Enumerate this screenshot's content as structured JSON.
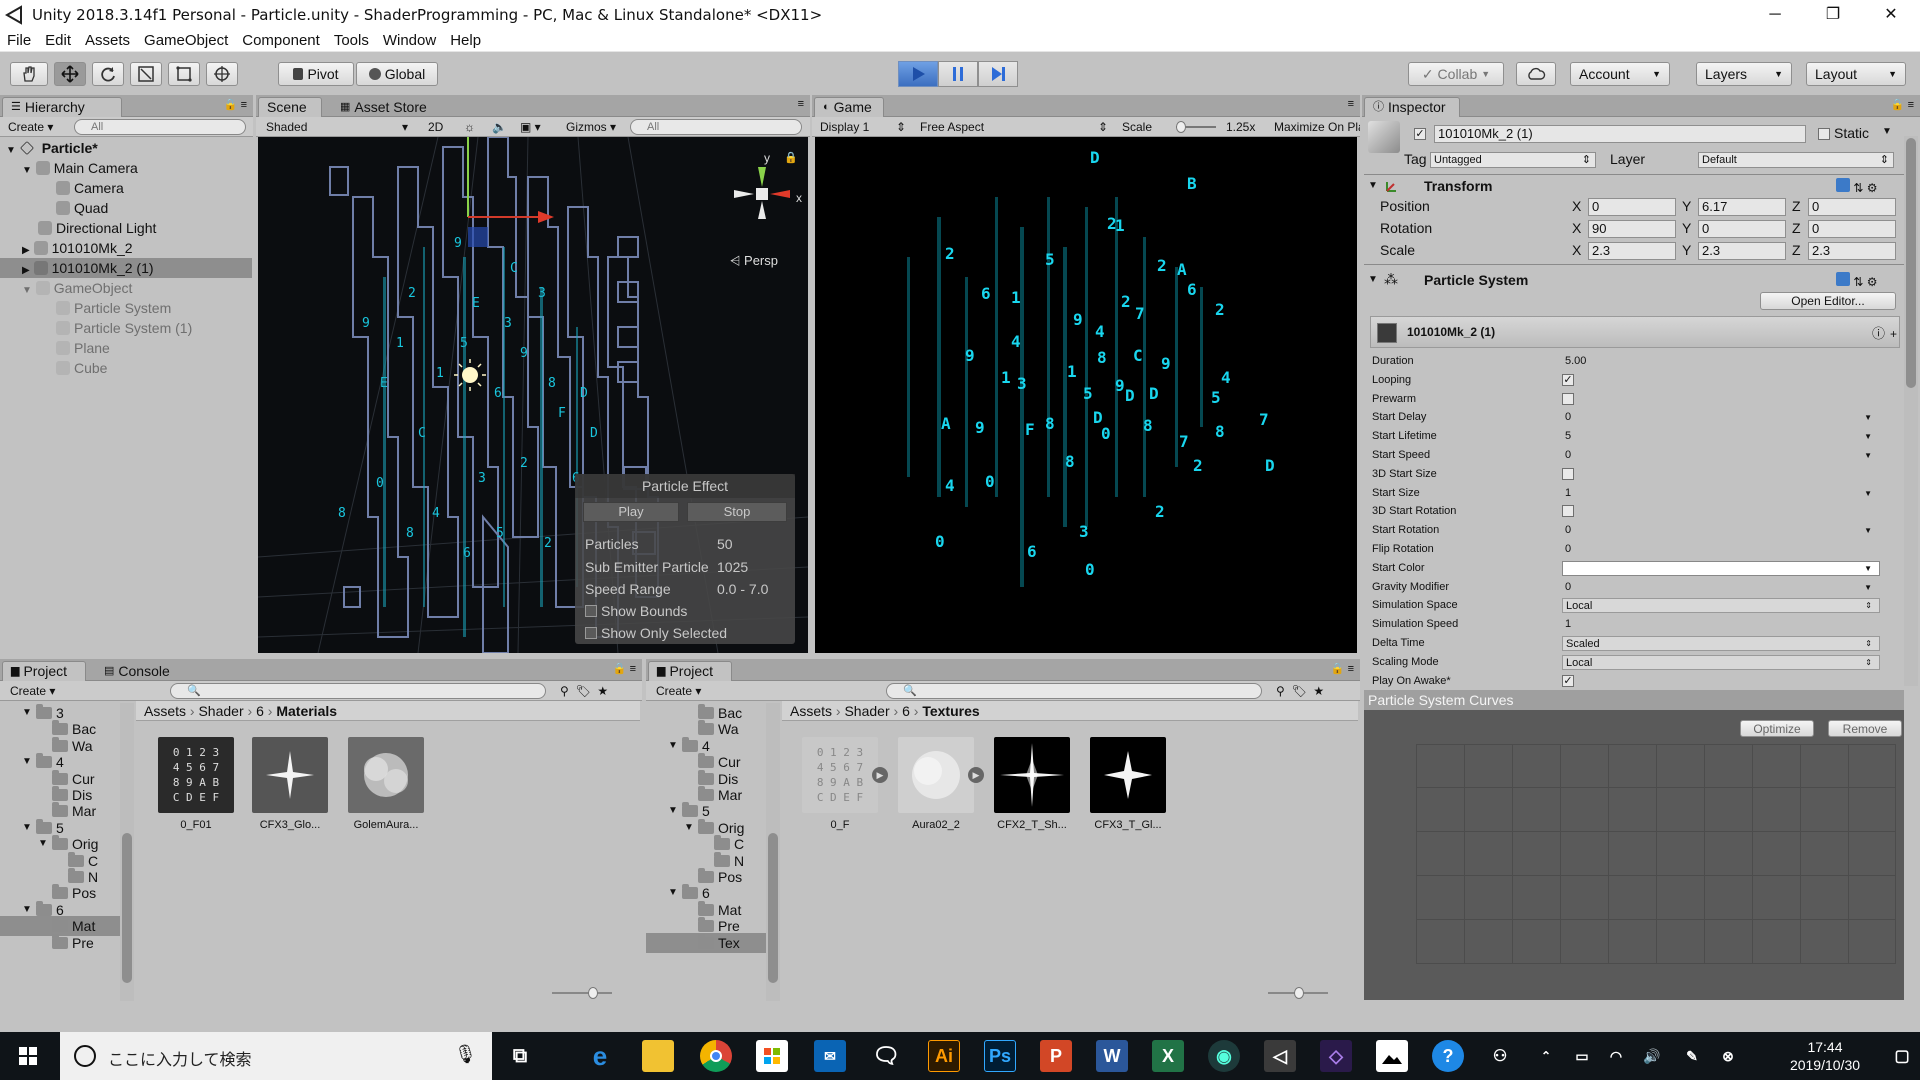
{
  "window": {
    "title": "Unity 2018.3.14f1 Personal - Particle.unity - ShaderProgramming - PC, Mac & Linux Standalone* <DX11>",
    "minimize": "─",
    "maximize": "❐",
    "close": "✕"
  },
  "menu": [
    "File",
    "Edit",
    "Assets",
    "GameObject",
    "Component",
    "Tools",
    "Window",
    "Help"
  ],
  "toolbar": {
    "pivot": "Pivot",
    "global": "Global",
    "collab": "Collab",
    "account": "Account",
    "layers": "Layers",
    "layout": "Layout"
  },
  "hierarchy": {
    "tab": "Hierarchy",
    "create": "Create",
    "search_placeholder": "All",
    "scene": "Particle*",
    "items": [
      {
        "label": "Main Camera"
      },
      {
        "label": "Camera"
      },
      {
        "label": "Quad"
      },
      {
        "label": "Directional Light"
      },
      {
        "label": "101010Mk_2"
      },
      {
        "label": "101010Mk_2 (1)"
      },
      {
        "label": "GameObject"
      },
      {
        "label": "Particle System"
      },
      {
        "label": "Particle System (1)"
      },
      {
        "label": "Plane"
      },
      {
        "label": "Cube"
      }
    ]
  },
  "scene": {
    "tab": "Scene",
    "asset_store_tab": "Asset Store",
    "shading": "Shaded",
    "mode_2d": "2D",
    "gizmos": "Gizmos",
    "search_placeholder": "All",
    "persp": "Persp",
    "axis_x": "x",
    "axis_y": "y"
  },
  "particle_effect": {
    "title": "Particle Effect",
    "play": "Play",
    "stop": "Stop",
    "particles_label": "Particles",
    "particles_value": "50",
    "sub_emitter_label": "Sub Emitter Particle",
    "sub_emitter_value": "1025",
    "speed_label": "Speed Range",
    "speed_value": "0.0 - 7.0",
    "show_bounds": "Show Bounds",
    "show_only_selected": "Show Only Selected"
  },
  "game": {
    "tab": "Game",
    "display": "Display 1",
    "aspect": "Free Aspect",
    "scale_label": "Scale",
    "scale_value": "1.25x",
    "maximize": "Maximize On Pla"
  },
  "inspector": {
    "tab": "Inspector",
    "object_name": "101010Mk_2 (1)",
    "static": "Static",
    "tag_label": "Tag",
    "tag_value": "Untagged",
    "layer_label": "Layer",
    "layer_value": "Default",
    "transform": {
      "title": "Transform",
      "position_label": "Position",
      "rotation_label": "Rotation",
      "scale_label": "Scale",
      "position": {
        "x": "0",
        "y": "6.17",
        "z": "0"
      },
      "rotation": {
        "x": "90",
        "y": "0",
        "z": "0"
      },
      "scale": {
        "x": "2.3",
        "y": "2.3",
        "z": "2.3"
      }
    },
    "particle_system": {
      "title": "Particle System",
      "open_editor": "Open Editor...",
      "module_name": "101010Mk_2 (1)",
      "rows": [
        {
          "label": "Duration",
          "value": "5.00",
          "kind": "text"
        },
        {
          "label": "Looping",
          "value": "✓",
          "kind": "check"
        },
        {
          "label": "Prewarm",
          "value": "",
          "kind": "check"
        },
        {
          "label": "Start Delay",
          "value": "0",
          "kind": "drop"
        },
        {
          "label": "Start Lifetime",
          "value": "5",
          "kind": "drop"
        },
        {
          "label": "Start Speed",
          "value": "0",
          "kind": "drop"
        },
        {
          "label": "3D Start Size",
          "value": "",
          "kind": "check"
        },
        {
          "label": "Start Size",
          "value": "1",
          "kind": "drop"
        },
        {
          "label": "3D Start Rotation",
          "value": "",
          "kind": "check"
        },
        {
          "label": "Start Rotation",
          "value": "0",
          "kind": "drop"
        },
        {
          "label": "Flip Rotation",
          "value": "0",
          "kind": "text"
        },
        {
          "label": "Start Color",
          "value": "",
          "kind": "color"
        },
        {
          "label": "Gravity Modifier",
          "value": "0",
          "kind": "drop"
        },
        {
          "label": "Simulation Space",
          "value": "Local",
          "kind": "select"
        },
        {
          "label": "Simulation Speed",
          "value": "1",
          "kind": "text"
        },
        {
          "label": "Delta Time",
          "value": "Scaled",
          "kind": "select"
        },
        {
          "label": "Scaling Mode",
          "value": "Local",
          "kind": "select"
        },
        {
          "label": "Play On Awake*",
          "value": "✓",
          "kind": "check"
        }
      ]
    },
    "curves": {
      "title": "Particle System Curves",
      "optimize": "Optimize",
      "remove": "Remove"
    }
  },
  "project_left": {
    "tab": "Project",
    "console_tab": "Console",
    "create": "Create",
    "breadcrumb": [
      "Assets",
      "Shader",
      "6",
      "Materials"
    ],
    "tree": [
      {
        "label": "3",
        "indent": 0,
        "arrow": "▼"
      },
      {
        "label": "Bac",
        "indent": 1,
        "arrow": ""
      },
      {
        "label": "Wa",
        "indent": 1,
        "arrow": ""
      },
      {
        "label": "4",
        "indent": 0,
        "arrow": "▼"
      },
      {
        "label": "Cur",
        "indent": 1,
        "arrow": ""
      },
      {
        "label": "Dis",
        "indent": 1,
        "arrow": ""
      },
      {
        "label": "Mar",
        "indent": 1,
        "arrow": ""
      },
      {
        "label": "5",
        "indent": 0,
        "arrow": "▼"
      },
      {
        "label": "Orig",
        "indent": 1,
        "arrow": "▼"
      },
      {
        "label": "C",
        "indent": 2,
        "arrow": ""
      },
      {
        "label": "N",
        "indent": 2,
        "arrow": ""
      },
      {
        "label": "Pos",
        "indent": 1,
        "arrow": ""
      },
      {
        "label": "6",
        "indent": 0,
        "arrow": "▼"
      },
      {
        "label": "Mat",
        "indent": 1,
        "arrow": ""
      },
      {
        "label": "Pre",
        "indent": 1,
        "arrow": ""
      }
    ],
    "assets": [
      {
        "label": "0_F01",
        "thumb": "hex"
      },
      {
        "label": "CFX3_Glo...",
        "thumb": "star"
      },
      {
        "label": "GolemAura...",
        "thumb": "cloud"
      }
    ]
  },
  "project_right": {
    "tab": "Project",
    "create": "Create",
    "breadcrumb": [
      "Assets",
      "Shader",
      "6",
      "Textures"
    ],
    "tree": [
      {
        "label": "Bac",
        "indent": 1,
        "arrow": ""
      },
      {
        "label": "Wa",
        "indent": 1,
        "arrow": ""
      },
      {
        "label": "4",
        "indent": 0,
        "arrow": "▼"
      },
      {
        "label": "Cur",
        "indent": 1,
        "arrow": ""
      },
      {
        "label": "Dis",
        "indent": 1,
        "arrow": ""
      },
      {
        "label": "Mar",
        "indent": 1,
        "arrow": ""
      },
      {
        "label": "5",
        "indent": 0,
        "arrow": "▼"
      },
      {
        "label": "Orig",
        "indent": 1,
        "arrow": "▼"
      },
      {
        "label": "C",
        "indent": 2,
        "arrow": ""
      },
      {
        "label": "N",
        "indent": 2,
        "arrow": ""
      },
      {
        "label": "Pos",
        "indent": 1,
        "arrow": ""
      },
      {
        "label": "6",
        "indent": 0,
        "arrow": "▼"
      },
      {
        "label": "Mat",
        "indent": 1,
        "arrow": ""
      },
      {
        "label": "Pre",
        "indent": 1,
        "arrow": ""
      },
      {
        "label": "Tex",
        "indent": 1,
        "arrow": ""
      }
    ],
    "assets": [
      {
        "label": "0_F",
        "thumb": "hex"
      },
      {
        "label": "Aura02_2",
        "thumb": "cloud"
      },
      {
        "label": "CFX2_T_Sh...",
        "thumb": "star"
      },
      {
        "label": "CFX3_T_Gl...",
        "thumb": "star"
      }
    ]
  },
  "hex_thumb_text": "0 1 2 3\n4 5 6 7\n8 9 A B\nC D E F",
  "taskbar": {
    "search_placeholder": "ここに入力して検索",
    "time": "17:44",
    "date": "2019/10/30",
    "apps": [
      "task-view",
      "edge",
      "explorer",
      "chrome",
      "store",
      "outlook-mail",
      "line",
      "illustrator",
      "photoshop",
      "powerpoint",
      "word",
      "excel",
      "gitkraken",
      "unity",
      "visual-studio",
      "photos",
      "help"
    ],
    "ai_label": "Ai",
    "ps_label": "Ps",
    "pp_label": "P",
    "word_label": "W",
    "excel_label": "X"
  }
}
